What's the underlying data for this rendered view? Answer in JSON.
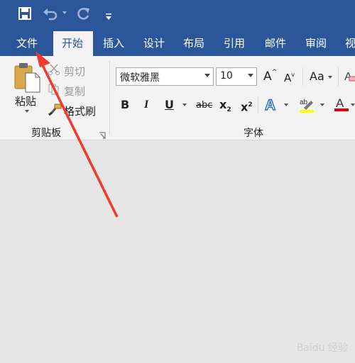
{
  "qat": {
    "save_icon": "save-icon",
    "undo_icon": "undo-icon",
    "redo_icon": "redo-icon",
    "customize_icon": "customize-qat-icon"
  },
  "tabs": [
    {
      "label": "文件"
    },
    {
      "label": "开始"
    },
    {
      "label": "插入"
    },
    {
      "label": "设计"
    },
    {
      "label": "布局"
    },
    {
      "label": "引用"
    },
    {
      "label": "邮件"
    },
    {
      "label": "审阅"
    },
    {
      "label": "视"
    }
  ],
  "clipboard": {
    "paste_label": "粘贴",
    "cut_label": "剪切",
    "copy_label": "复制",
    "format_painter_label": "格式刷",
    "group_label": "剪贴板"
  },
  "font": {
    "font_name": "微软雅黑",
    "font_size": "10",
    "grow_label": "A",
    "shrink_label": "A",
    "case_label": "Aa",
    "bold": "B",
    "italic": "I",
    "underline": "U",
    "strike": "abc",
    "subscript_base": "x",
    "subscript_sub": "2",
    "superscript_base": "x",
    "superscript_sup": "2",
    "effects_label": "A",
    "highlight_label": "ab",
    "color_label": "A",
    "group_label": "字体"
  },
  "colors": {
    "accent": "#2b579a",
    "highlight": "#ffff00",
    "font_color": "#e00000",
    "arrow": "#f03a2e"
  },
  "watermark": "Baidu 经验"
}
